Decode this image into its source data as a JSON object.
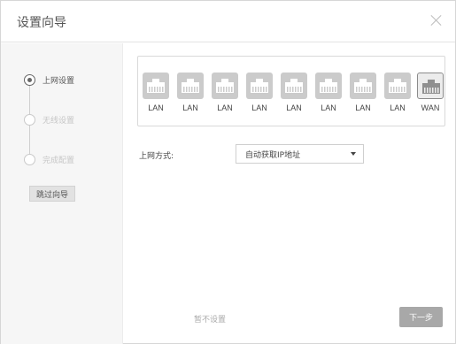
{
  "dialog": {
    "title": "设置向导"
  },
  "steps": [
    {
      "label": "上网设置",
      "state": "active"
    },
    {
      "label": "无线设置",
      "state": "inactive"
    },
    {
      "label": "完成配置",
      "state": "inactive"
    }
  ],
  "sidebar": {
    "skip_label": "跳过向导"
  },
  "ports": [
    "LAN",
    "LAN",
    "LAN",
    "LAN",
    "LAN",
    "LAN",
    "LAN",
    "LAN",
    "WAN"
  ],
  "connection": {
    "label": "上网方式:",
    "selected": "自动获取IP地址"
  },
  "footer": {
    "later_label": "暂不设置",
    "next_label": "下一步"
  },
  "colors": {
    "next_button": "#a8a8a8",
    "active_step": "#666666",
    "inactive_step": "#c6c6c6"
  }
}
